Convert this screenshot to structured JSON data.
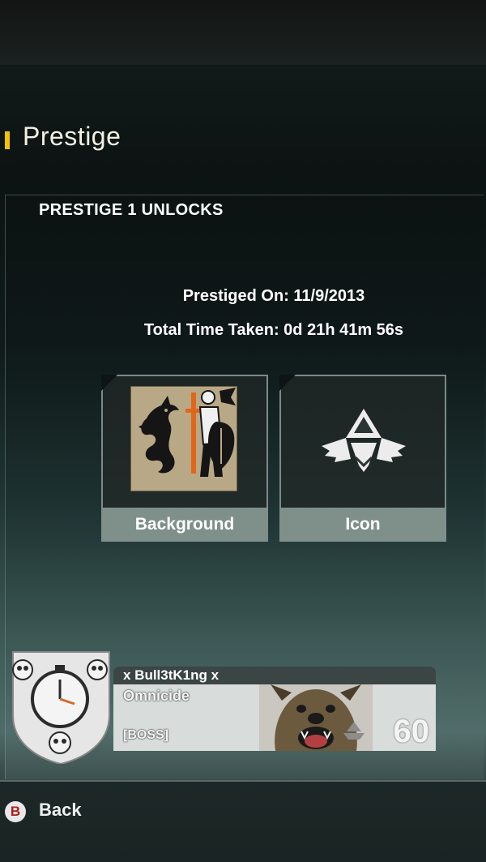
{
  "header": {
    "title": "Prestige"
  },
  "panel": {
    "heading": "PRESTIGE 1 UNLOCKS",
    "prestiged_on": "Prestiged On: 11/9/2013",
    "total_time": "Total Time Taken: 0d 21h 41m 56s"
  },
  "unlocks": [
    {
      "label": "Background",
      "icon": "knight-dragon-background-icon"
    },
    {
      "label": "Icon",
      "icon": "winged-pyramid-emblem-icon"
    }
  ],
  "player": {
    "name": "x Bull3tK1ng x",
    "title": "Omnicide",
    "clan": "[BOSS]",
    "level": "60",
    "emblem": "stopwatch-skulls-emblem-icon"
  },
  "footer": {
    "button": "B",
    "label": "Back"
  },
  "colors": {
    "accent": "#f5c400",
    "card_caption": "#7f908b",
    "back_button": "#b21b1b"
  }
}
